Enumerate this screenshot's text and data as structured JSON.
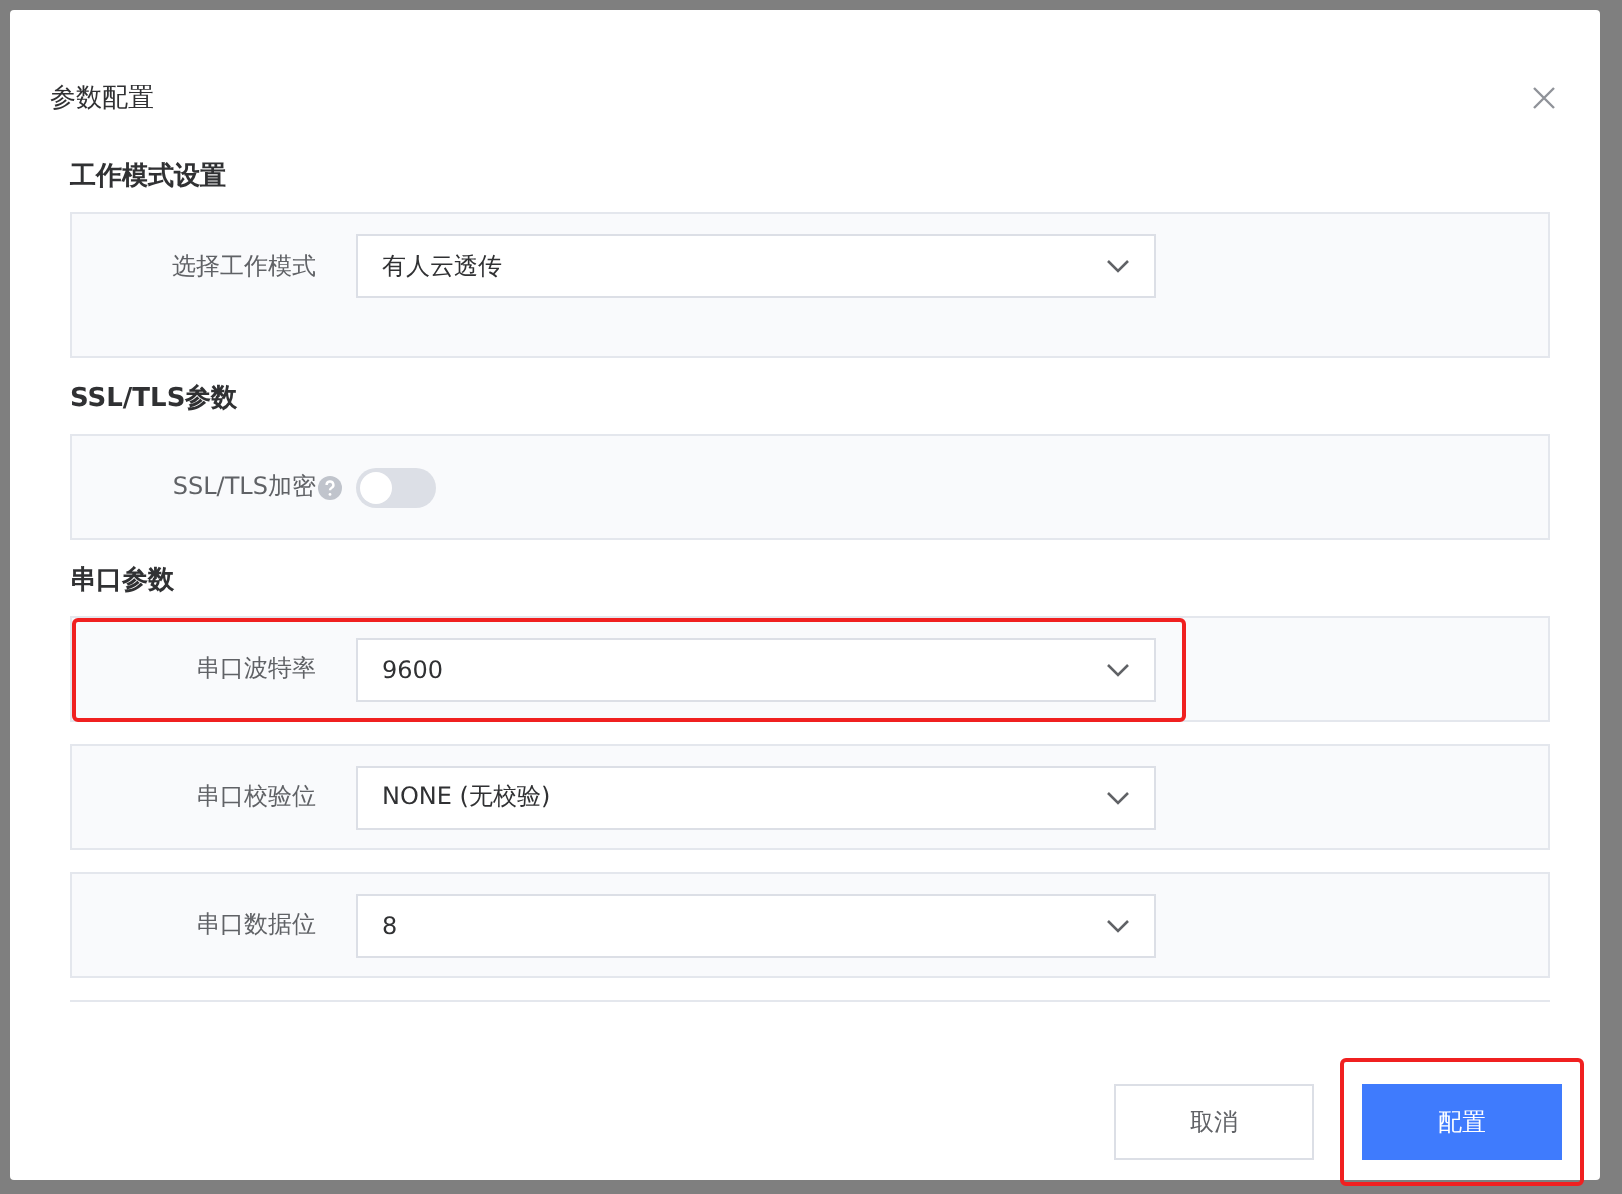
{
  "dialog": {
    "title": "参数配置"
  },
  "sections": [
    {
      "heading": "工作模式设置",
      "rows": [
        {
          "kind": "select",
          "label": "选择工作模式",
          "value": "有人云透传",
          "highlighted": false
        }
      ]
    },
    {
      "heading": "SSL/TLS参数",
      "rows": [
        {
          "kind": "switch",
          "label": "SSL/TLS加密",
          "help": true,
          "on": false,
          "highlighted": false
        }
      ]
    },
    {
      "heading": "串口参数",
      "rows": [
        {
          "kind": "select",
          "label": "串口波特率",
          "value": "9600",
          "highlighted": true
        },
        {
          "kind": "select",
          "label": "串口校验位",
          "value": "NONE (无校验)",
          "highlighted": false
        },
        {
          "kind": "select",
          "label": "串口数据位",
          "value": "8",
          "highlighted": false
        }
      ]
    }
  ],
  "buttons": [
    {
      "label": "取消",
      "kind": "secondary",
      "highlighted": false
    },
    {
      "label": "配置",
      "kind": "primary",
      "highlighted": true
    }
  ]
}
